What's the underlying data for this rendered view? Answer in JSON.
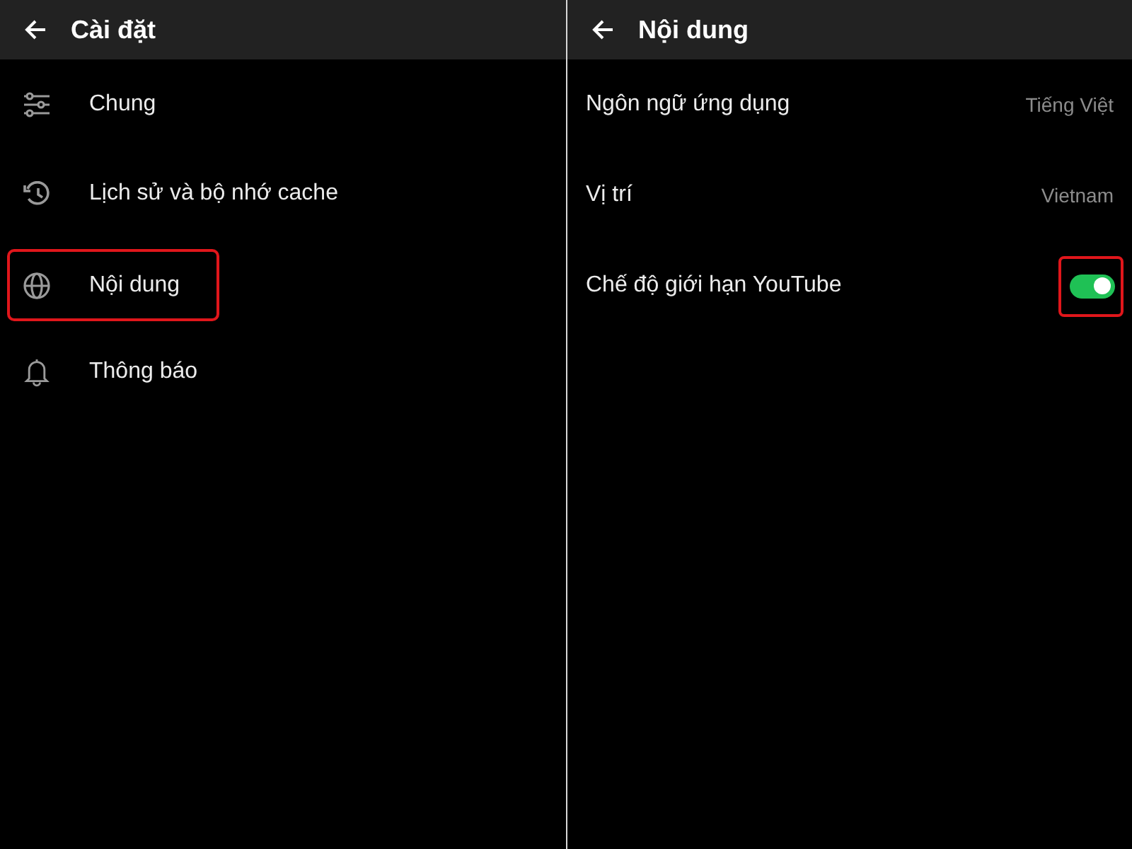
{
  "left_panel": {
    "header": {
      "title": "Cài đặt"
    },
    "items": [
      {
        "label": "Chung",
        "highlighted": false
      },
      {
        "label": "Lịch sử và bộ nhớ cache",
        "highlighted": false
      },
      {
        "label": "Nội dung",
        "highlighted": true
      },
      {
        "label": "Thông báo",
        "highlighted": false
      }
    ]
  },
  "right_panel": {
    "header": {
      "title": "Nội dung"
    },
    "rows": [
      {
        "kind": "value",
        "label": "Ngôn ngữ ứng dụng",
        "value": "Tiếng Việt"
      },
      {
        "kind": "value",
        "label": "Vị trí",
        "value": "Vietnam"
      },
      {
        "kind": "toggle",
        "label": "Chế độ giới hạn YouTube",
        "on": true,
        "highlighted": true
      }
    ]
  }
}
